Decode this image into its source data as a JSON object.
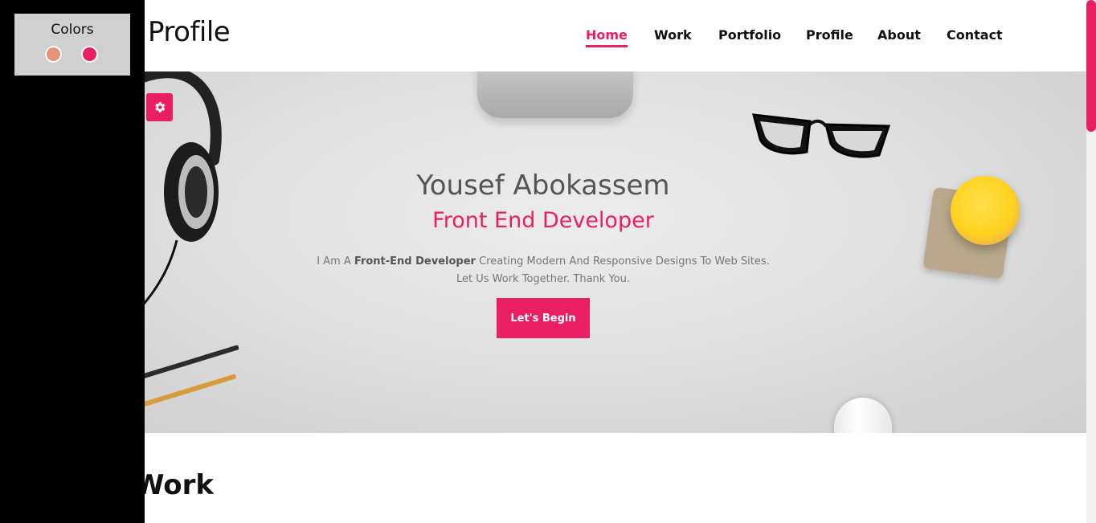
{
  "header": {
    "brand": "Profile",
    "nav": [
      {
        "label": "Home",
        "active": true
      },
      {
        "label": "Work"
      },
      {
        "label": "Portfolio"
      },
      {
        "label": "Profile"
      },
      {
        "label": "About"
      },
      {
        "label": "Contact"
      }
    ]
  },
  "hero": {
    "name": "Yousef Abokassem",
    "role": "Front End Developer",
    "description_prefix": "I Am A ",
    "description_bold": "Front-End Developer",
    "description_suffix": " Creating Modern And Responsive Designs To Web Sites. Let Us Work Together. Thank You.",
    "button_label": "Let's Begin"
  },
  "work": {
    "title": "Work"
  },
  "settings_panel": {
    "title": "Colors",
    "swatches": [
      "#e6957a",
      "#e91e63"
    ],
    "toggle_icon": "gear-icon"
  },
  "theme": {
    "accent": "#e91e63"
  }
}
